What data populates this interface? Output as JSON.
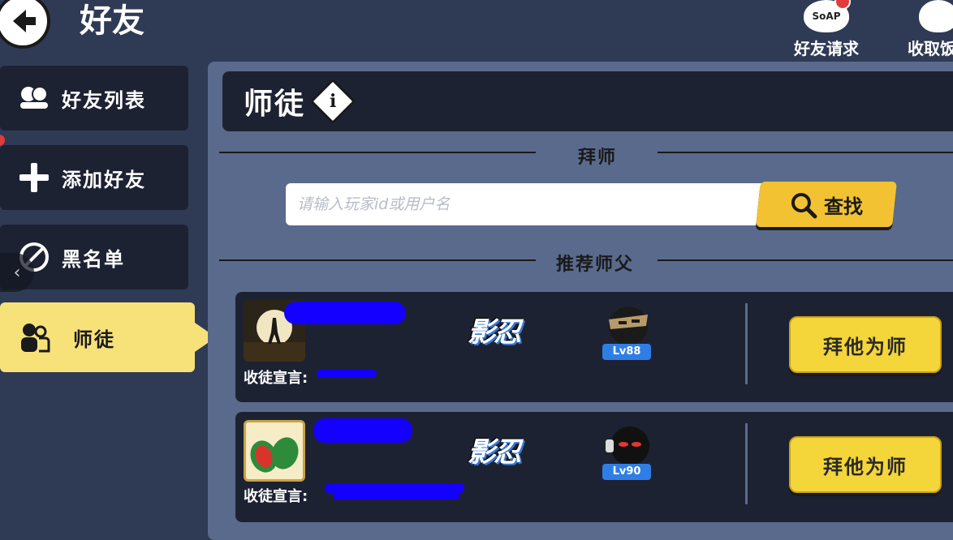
{
  "header": {
    "title": "好友",
    "actions": [
      {
        "label": "好友请求",
        "icon": "soap-bubble-icon",
        "icon_text": "SoAP",
        "badge_color": "#e23b3b"
      },
      {
        "label": "收取饭",
        "icon": "rice-ball-icon"
      }
    ]
  },
  "sidebar": {
    "items": [
      {
        "label": "好友列表",
        "icon": "friends-icon"
      },
      {
        "label": "添加好友",
        "icon": "plus-icon"
      },
      {
        "label": "黑名单",
        "icon": "blocked-icon"
      },
      {
        "label": "师徒",
        "icon": "mentor-icon",
        "active": true
      }
    ],
    "collapse_glyph": "‹"
  },
  "main": {
    "section_title": "师徒",
    "info_glyph": "i",
    "find_master": {
      "heading": "拜师",
      "search_placeholder": "请输入玩家id或用户名",
      "search_button": "查找"
    },
    "recommended": {
      "heading": "推荐师父",
      "cards": [
        {
          "clan": "影忍",
          "level": "Lv88",
          "motto_label": "收徒宣言:",
          "button": "拜他为师"
        },
        {
          "clan": "影忍",
          "level": "Lv90",
          "motto_label": "收徒宣言:",
          "button": "拜他为师"
        }
      ]
    }
  },
  "colors": {
    "background": "#2f3a55",
    "panel": "#5a6a8c",
    "dark_tile": "#1d2232",
    "active_tab": "#f7e27a",
    "button_yellow": "#f4d53a",
    "search_yellow": "#f2c233",
    "level_blue": "#2f7ee6",
    "redaction": "#1400ff"
  }
}
